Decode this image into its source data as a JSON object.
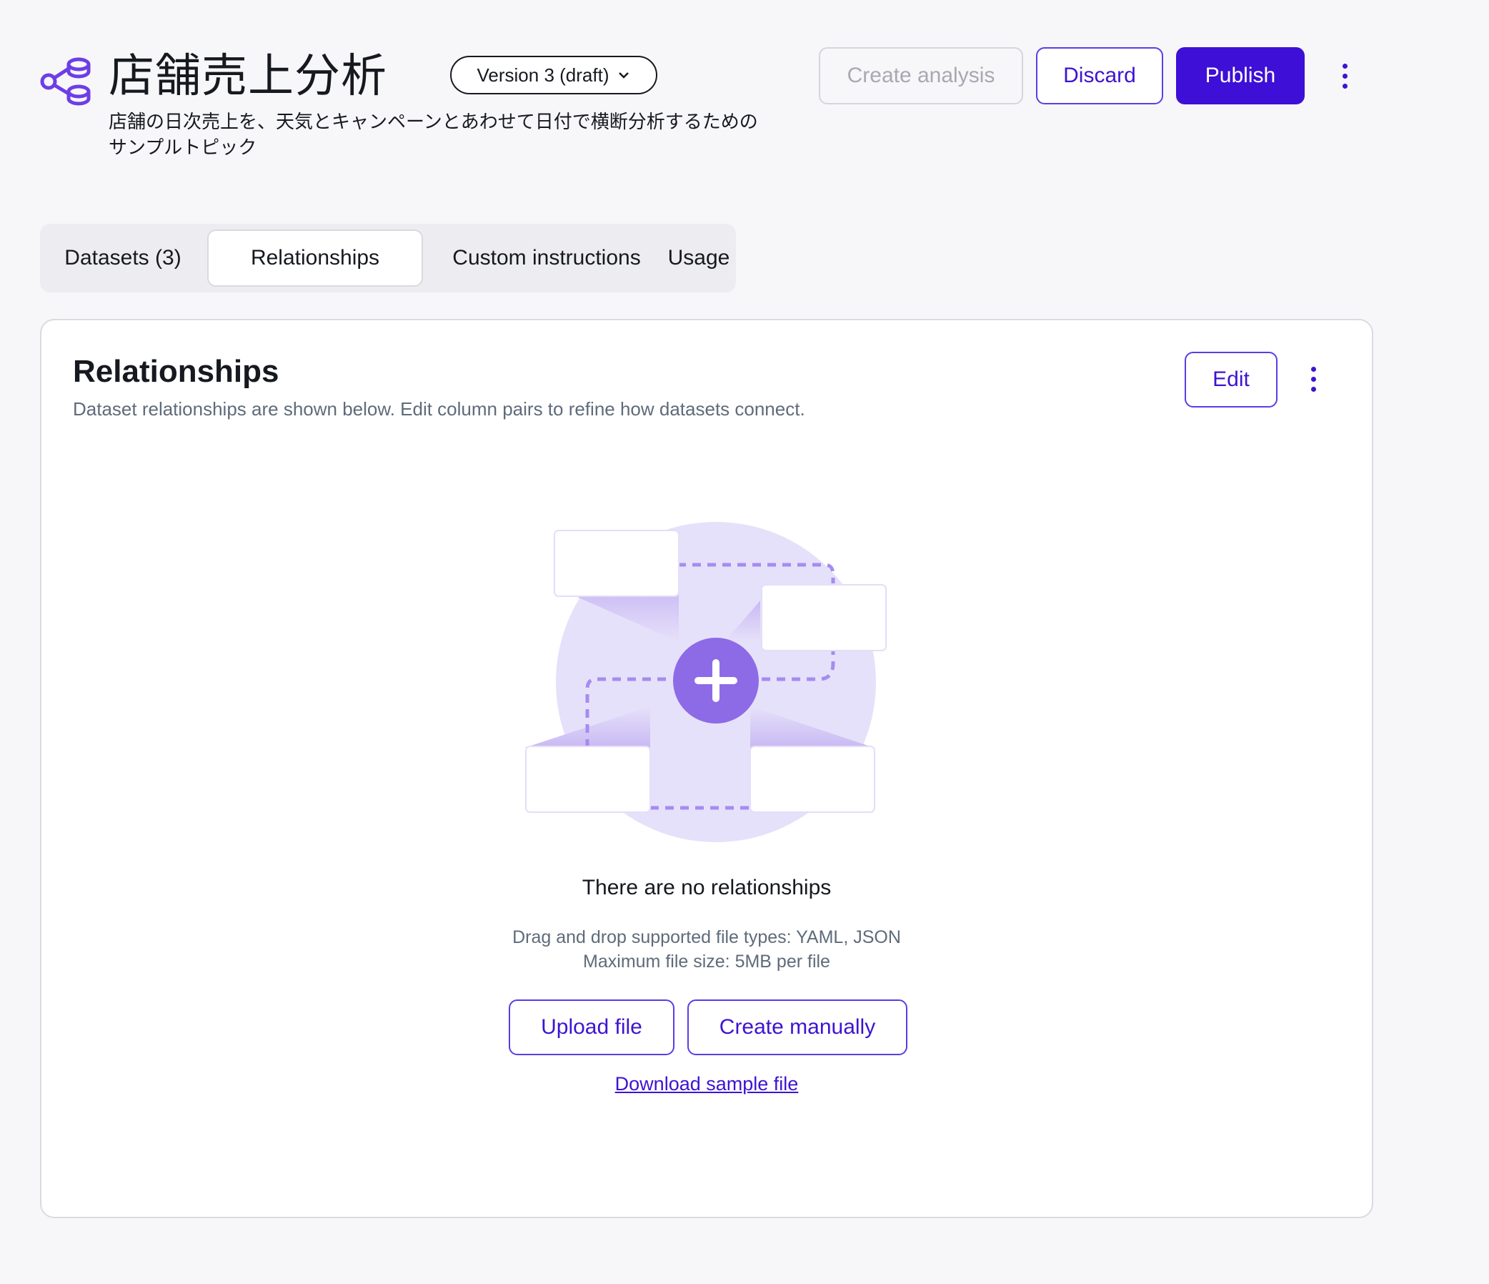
{
  "header": {
    "topic_icon": "topic-network-icon",
    "title": "店舗売上分析",
    "version_label": "Version 3 (draft)",
    "version_icon": "chevron-down-icon",
    "description": "店舗の日次売上を、天気とキャンペーンとあわせて日付で横断分析するためのサンプルトピック",
    "create_analysis_label": "Create analysis",
    "discard_label": "Discard",
    "publish_label": "Publish",
    "more_icon": "kebab-menu-icon"
  },
  "tabs": [
    {
      "label": "Datasets (3)",
      "active": false
    },
    {
      "label": "Relationships",
      "active": true
    },
    {
      "label": "Custom instructions",
      "active": false
    },
    {
      "label": "Usage",
      "active": false
    }
  ],
  "panel": {
    "title": "Relationships",
    "subtitle": "Dataset relationships are shown below. Edit column pairs to refine how datasets connect.",
    "edit_label": "Edit",
    "more_icon": "kebab-menu-icon",
    "empty_state": {
      "illustration_icon": "add-relationship-illustration",
      "title": "There are no relationships",
      "hint_types": "Drag and drop supported file types: YAML, JSON",
      "hint_size": "Maximum file size: 5MB per file",
      "upload_label": "Upload file",
      "create_label": "Create manually",
      "download_label": "Download sample file"
    }
  },
  "colors": {
    "accent": "#3e13d1",
    "accent_border": "#5b3ce6",
    "publish_bg": "#3e0fd6",
    "illustration_circle": "#e6e1fa",
    "illustration_plus": "#8d6be6"
  }
}
